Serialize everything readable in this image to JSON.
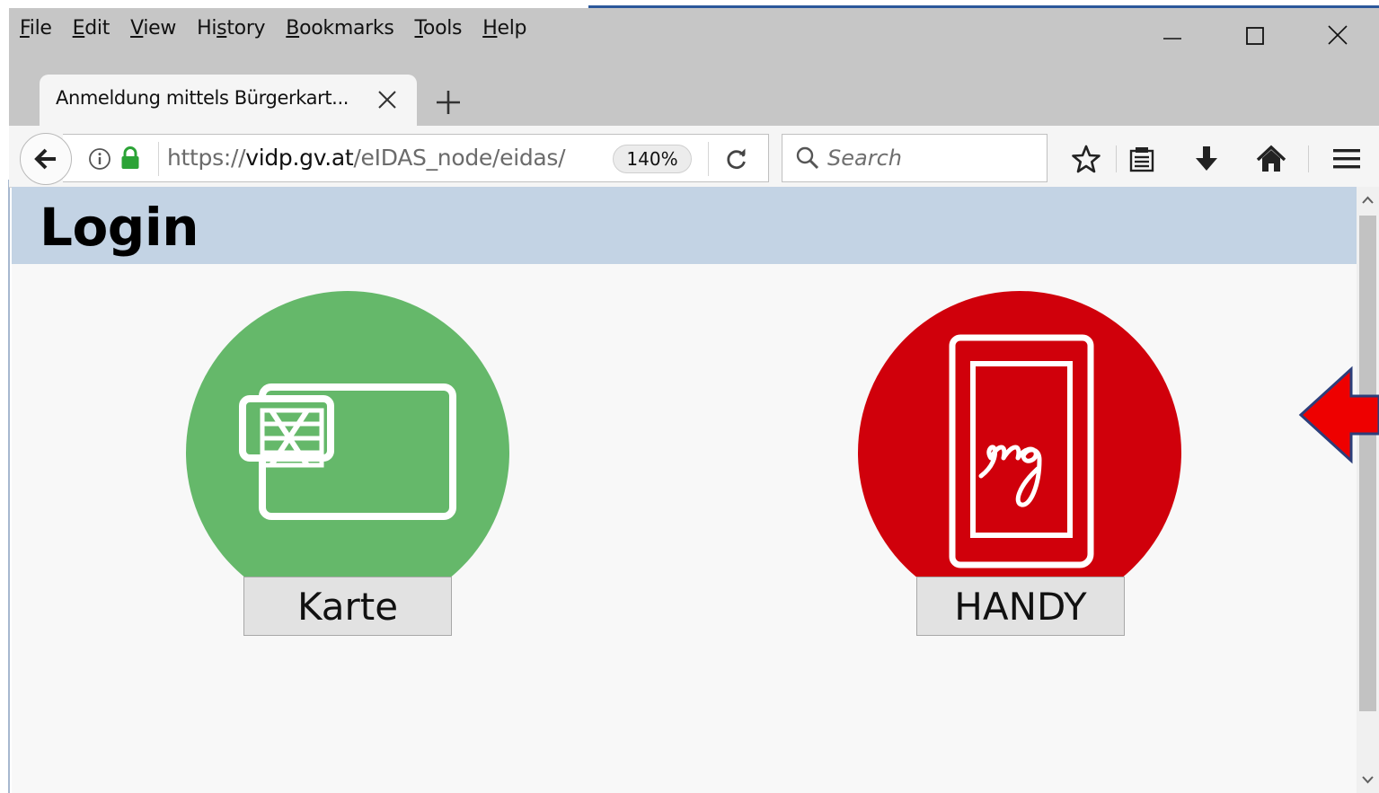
{
  "browser": {
    "menu": [
      {
        "name": "file",
        "pre": "",
        "u": "F",
        "post": "ile"
      },
      {
        "name": "edit",
        "pre": "",
        "u": "E",
        "post": "dit"
      },
      {
        "name": "view",
        "pre": "",
        "u": "V",
        "post": "iew"
      },
      {
        "name": "history",
        "pre": "Hi",
        "u": "s",
        "post": "tory"
      },
      {
        "name": "bookmarks",
        "pre": "",
        "u": "B",
        "post": "ookmarks"
      },
      {
        "name": "tools",
        "pre": "",
        "u": "T",
        "post": "ools"
      },
      {
        "name": "help",
        "pre": "",
        "u": "H",
        "post": "elp"
      }
    ],
    "tab": {
      "title": "Anmeldung mittels Bürgerkart..."
    },
    "url": {
      "scheme": "https://",
      "domain": "vidp.gv.at",
      "path": "/eIDAS_node/eidas/"
    },
    "zoom": "140%",
    "search": {
      "placeholder": "Search"
    },
    "colors": {
      "chrome": "#c6c6c6",
      "toolbar": "#f5f5f5",
      "lock": "#2ba336"
    }
  },
  "page": {
    "title": "Login",
    "header_color": "#c3d3e4",
    "options": {
      "card": {
        "label": "Karte",
        "color": "#65b86a",
        "icon": "smart-card-icon"
      },
      "handy": {
        "label": "HANDY",
        "color": "#d0000b",
        "icon": "mobile-signature-icon"
      }
    },
    "annotation": {
      "icon": "red-arrow-icon",
      "color": "#ee0000"
    }
  }
}
